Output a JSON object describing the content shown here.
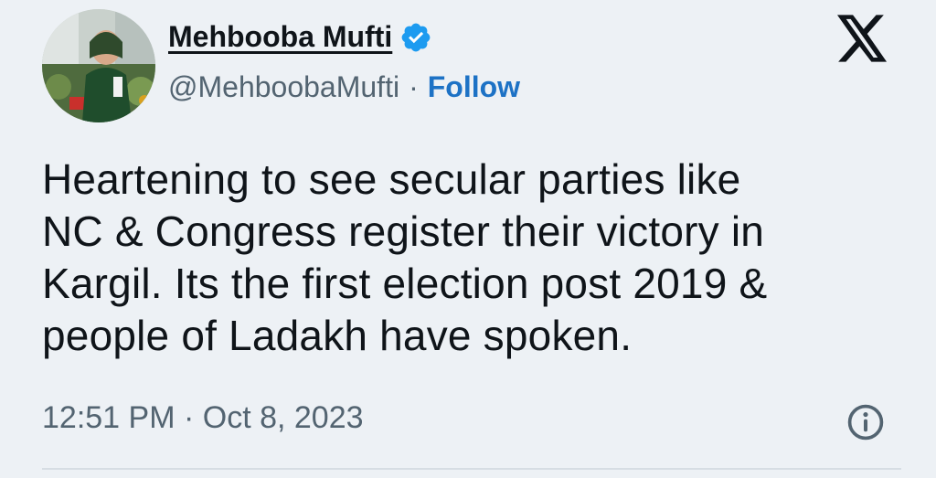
{
  "author": {
    "display_name": "Mehbooba Mufti",
    "handle": "@MehboobaMufti",
    "separator": "·",
    "follow_label": "Follow",
    "verified": true
  },
  "icons": {
    "verified": "verified-badge-icon",
    "platform": "x-logo-icon",
    "info": "info-icon"
  },
  "tweet": {
    "text": "Heartening to see secular parties like\nNC & Congress register their victory in\nKargil. Its the first election post 2019 &\npeople of Ladakh have spoken.",
    "timestamp": "12:51 PM · Oct 8, 2023"
  },
  "colors": {
    "background": "#edf1f5",
    "follow": "#1d72c5",
    "verified": "#1d9bf0",
    "secondary_text": "#536471"
  }
}
